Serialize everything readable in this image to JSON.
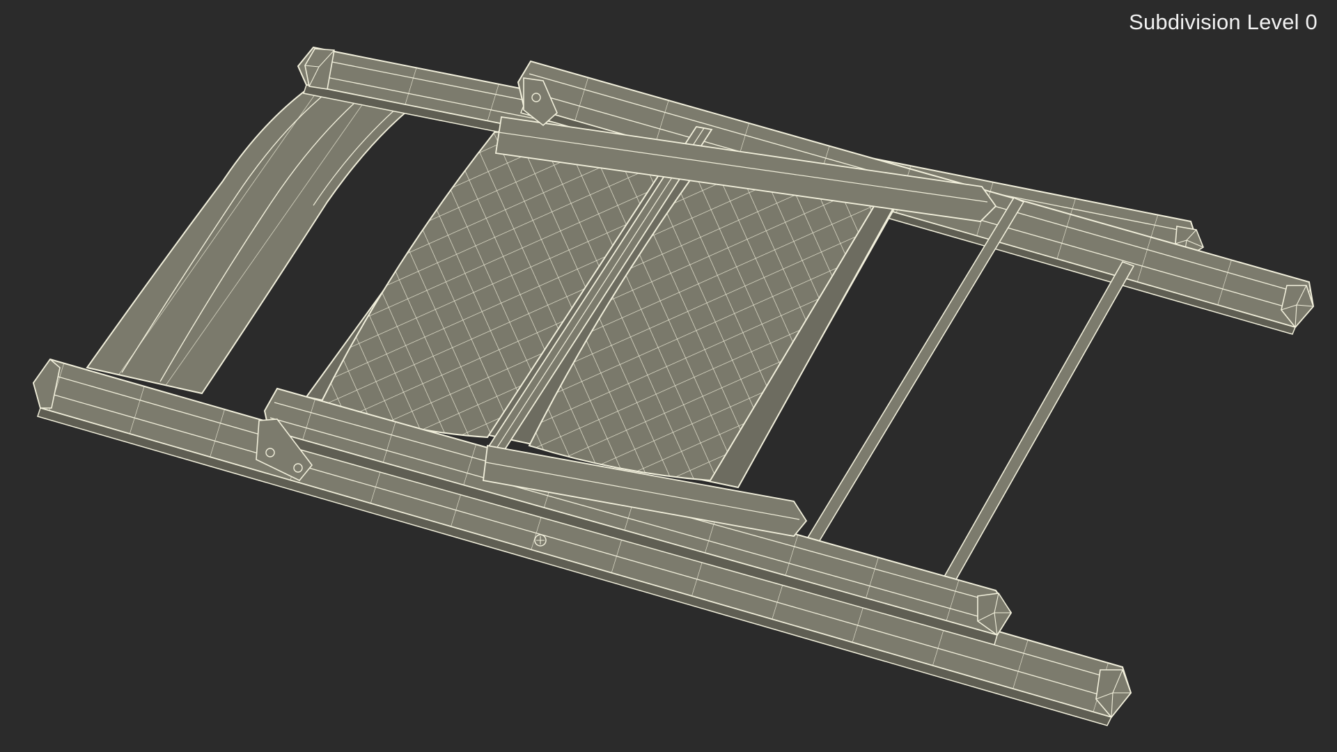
{
  "viewport": {
    "overlay_label": "Subdivision Level 0",
    "background_color": "#2b2b2b",
    "model_fill_color": "#7c7b6d",
    "model_shadow_color": "#5f5e53",
    "wireframe_color": "#f2f0dc"
  }
}
